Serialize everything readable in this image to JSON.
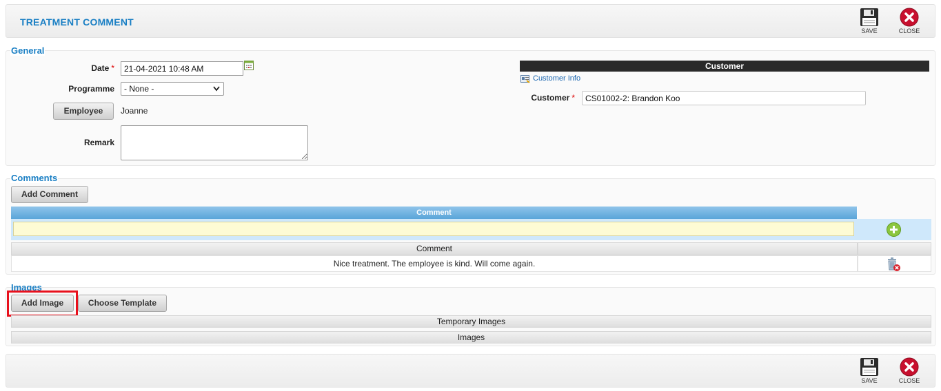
{
  "header": {
    "title": "TREATMENT COMMENT",
    "save_label": "SAVE",
    "close_label": "CLOSE"
  },
  "general": {
    "legend": "General",
    "date_label": "Date",
    "date_value": "21-04-2021 10:48 AM",
    "programme_label": "Programme",
    "programme_selected": "- None -",
    "employee_button": "Employee",
    "employee_value": "Joanne",
    "remark_label": "Remark",
    "remark_value": "",
    "customer_header": "Customer",
    "customer_info_link": "Customer Info",
    "customer_label": "Customer",
    "customer_value": "CS01002-2: Brandon Koo",
    "required_mark": "*"
  },
  "comments": {
    "legend": "Comments",
    "add_button": "Add Comment",
    "grid_header": "Comment",
    "new_comment_value": "",
    "list_header": "Comment",
    "rows": [
      {
        "text": "Nice treatment. The employee is kind. Will come again."
      }
    ]
  },
  "images": {
    "legend": "Images",
    "add_button": "Add Image",
    "template_button": "Choose Template",
    "temporary_header": "Temporary Images",
    "images_header": "Images"
  },
  "colors": {
    "accent": "#1a7fc4",
    "highlight_box": "#e8101c",
    "grid_header": "#5aa5d9"
  }
}
